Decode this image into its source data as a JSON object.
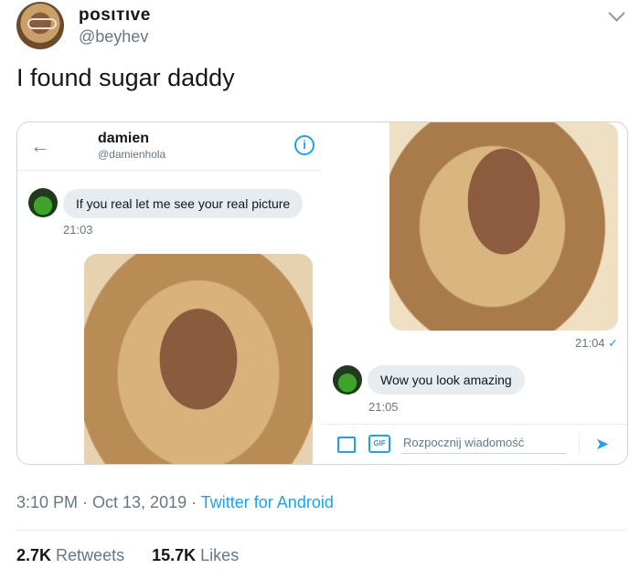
{
  "tweet": {
    "display_name": "posιтιve",
    "handle": "@beyhev",
    "text": "I found sugar daddy",
    "time": "3:10 PM · Oct 13, 2019 · ",
    "source": "Twitter for Android",
    "retweets_count": "2.7K",
    "retweets_label": "Retweets",
    "likes_count": "15.7K",
    "likes_label": "Likes"
  },
  "dm": {
    "contact_name": "damien",
    "contact_handle": "@damienhola",
    "msg1": "If you real let me see your real picture",
    "msg1_time": "21:03",
    "photo_time": "21:04",
    "msg2": "Wow you look amazing",
    "msg2_time": "21:05",
    "compose_placeholder": "Rozpocznij wiadomość",
    "gif_label": "GIF",
    "info_glyph": "i"
  }
}
